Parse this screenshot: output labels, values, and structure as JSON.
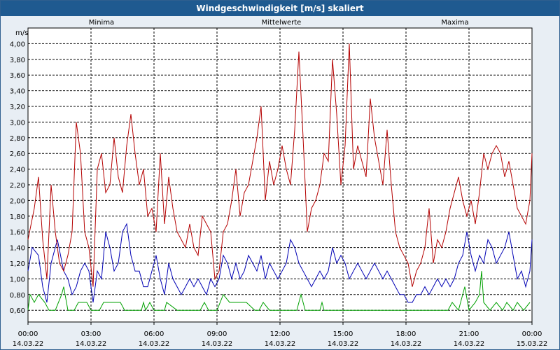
{
  "window": {
    "title": "Windgeschwindigkeit [m/s] skaliert"
  },
  "chart_data": {
    "type": "line",
    "title": "Windgeschwindigkeit [m/s] skaliert",
    "ylabel": "m/s",
    "ylim": [
      0.45,
      4.2
    ],
    "xlim": [
      "00:00",
      "24:00"
    ],
    "y_ticks": [
      "0,60",
      "0,80",
      "1,00",
      "1,20",
      "1,40",
      "1,60",
      "1,80",
      "2,00",
      "2,20",
      "2,40",
      "2,60",
      "2,80",
      "3,00",
      "3,20",
      "3,40",
      "3,60",
      "3,80",
      "4,00"
    ],
    "x_ticks": [
      {
        "time": "00:00",
        "date": "14.03.22"
      },
      {
        "time": "03:00",
        "date": "14.03.22"
      },
      {
        "time": "06:00",
        "date": "14.03.22"
      },
      {
        "time": "09:00",
        "date": "14.03.22"
      },
      {
        "time": "12:00",
        "date": "14.03.22"
      },
      {
        "time": "15:00",
        "date": "14.03.22"
      },
      {
        "time": "18:00",
        "date": "14.03.22"
      },
      {
        "time": "21:00",
        "date": "14.03.22"
      },
      {
        "time": "00:00",
        "date": "15.03.22"
      }
    ],
    "grid": true,
    "legend_position": "top",
    "series": [
      {
        "name": "Minima",
        "color": "#00a000",
        "points": [
          [
            0,
            0.6
          ],
          [
            0.1,
            0.8
          ],
          [
            0.3,
            0.7
          ],
          [
            0.5,
            0.8
          ],
          [
            0.8,
            0.7
          ],
          [
            1.0,
            0.6
          ],
          [
            1.3,
            0.6
          ],
          [
            1.6,
            0.8
          ],
          [
            1.7,
            0.9
          ],
          [
            1.9,
            0.6
          ],
          [
            2.2,
            0.6
          ],
          [
            2.4,
            0.7
          ],
          [
            2.8,
            0.7
          ],
          [
            3.0,
            0.6
          ],
          [
            3.4,
            0.6
          ],
          [
            3.6,
            0.7
          ],
          [
            4.4,
            0.7
          ],
          [
            4.6,
            0.6
          ],
          [
            5.4,
            0.6
          ],
          [
            5.5,
            0.7
          ],
          [
            5.6,
            0.6
          ],
          [
            5.8,
            0.7
          ],
          [
            6.0,
            0.6
          ],
          [
            6.5,
            0.6
          ],
          [
            6.6,
            0.7
          ],
          [
            7.1,
            0.6
          ],
          [
            8.2,
            0.6
          ],
          [
            8.4,
            0.7
          ],
          [
            8.6,
            0.6
          ],
          [
            9.0,
            0.6
          ],
          [
            9.3,
            0.8
          ],
          [
            9.6,
            0.7
          ],
          [
            10.4,
            0.7
          ],
          [
            10.8,
            0.6
          ],
          [
            11.0,
            0.6
          ],
          [
            11.2,
            0.7
          ],
          [
            11.5,
            0.6
          ],
          [
            12.8,
            0.6
          ],
          [
            13.0,
            0.8
          ],
          [
            13.2,
            0.6
          ],
          [
            13.9,
            0.6
          ],
          [
            14.0,
            0.7
          ],
          [
            14.1,
            0.6
          ],
          [
            20.0,
            0.6
          ],
          [
            20.2,
            0.7
          ],
          [
            20.5,
            0.6
          ],
          [
            20.8,
            0.9
          ],
          [
            21.0,
            0.6
          ],
          [
            21.3,
            0.7
          ],
          [
            21.5,
            0.8
          ],
          [
            21.6,
            1.1
          ],
          [
            21.7,
            0.7
          ],
          [
            22.0,
            0.6
          ],
          [
            22.3,
            0.7
          ],
          [
            22.6,
            0.6
          ],
          [
            22.8,
            0.7
          ],
          [
            23.1,
            0.6
          ],
          [
            23.3,
            0.7
          ],
          [
            23.6,
            0.6
          ],
          [
            23.9,
            0.7
          ]
        ]
      },
      {
        "name": "Mittelwerte",
        "color": "#0000b4",
        "points": [
          [
            0,
            1.1
          ],
          [
            0.2,
            1.4
          ],
          [
            0.5,
            1.3
          ],
          [
            0.7,
            0.9
          ],
          [
            0.9,
            0.7
          ],
          [
            1.1,
            1.2
          ],
          [
            1.4,
            1.5
          ],
          [
            1.7,
            1.1
          ],
          [
            1.9,
            1.0
          ],
          [
            2.1,
            0.8
          ],
          [
            2.3,
            0.9
          ],
          [
            2.5,
            1.1
          ],
          [
            2.7,
            1.2
          ],
          [
            2.9,
            1.1
          ],
          [
            3.1,
            0.7
          ],
          [
            3.3,
            1.1
          ],
          [
            3.5,
            1.0
          ],
          [
            3.7,
            1.6
          ],
          [
            3.9,
            1.4
          ],
          [
            4.1,
            1.1
          ],
          [
            4.3,
            1.2
          ],
          [
            4.5,
            1.6
          ],
          [
            4.7,
            1.7
          ],
          [
            4.9,
            1.3
          ],
          [
            5.1,
            1.1
          ],
          [
            5.3,
            1.1
          ],
          [
            5.5,
            0.9
          ],
          [
            5.7,
            0.9
          ],
          [
            5.9,
            1.1
          ],
          [
            6.1,
            1.3
          ],
          [
            6.3,
            1.0
          ],
          [
            6.5,
            0.8
          ],
          [
            6.7,
            1.2
          ],
          [
            6.9,
            1.0
          ],
          [
            7.1,
            0.9
          ],
          [
            7.3,
            0.8
          ],
          [
            7.5,
            0.9
          ],
          [
            7.7,
            1.0
          ],
          [
            7.9,
            0.9
          ],
          [
            8.1,
            1.0
          ],
          [
            8.3,
            0.9
          ],
          [
            8.5,
            0.8
          ],
          [
            8.7,
            1.0
          ],
          [
            8.9,
            0.9
          ],
          [
            9.1,
            1.0
          ],
          [
            9.3,
            1.3
          ],
          [
            9.5,
            1.2
          ],
          [
            9.7,
            1.0
          ],
          [
            9.9,
            1.2
          ],
          [
            10.1,
            1.0
          ],
          [
            10.3,
            1.1
          ],
          [
            10.5,
            1.3
          ],
          [
            10.7,
            1.2
          ],
          [
            10.9,
            1.1
          ],
          [
            11.1,
            1.3
          ],
          [
            11.3,
            1.0
          ],
          [
            11.5,
            1.2
          ],
          [
            11.7,
            1.1
          ],
          [
            11.9,
            1.0
          ],
          [
            12.1,
            1.1
          ],
          [
            12.3,
            1.2
          ],
          [
            12.5,
            1.5
          ],
          [
            12.7,
            1.4
          ],
          [
            12.9,
            1.2
          ],
          [
            13.1,
            1.1
          ],
          [
            13.3,
            1.0
          ],
          [
            13.5,
            0.9
          ],
          [
            13.7,
            1.0
          ],
          [
            13.9,
            1.1
          ],
          [
            14.1,
            1.0
          ],
          [
            14.3,
            1.1
          ],
          [
            14.5,
            1.4
          ],
          [
            14.7,
            1.2
          ],
          [
            14.9,
            1.3
          ],
          [
            15.1,
            1.2
          ],
          [
            15.3,
            1.0
          ],
          [
            15.5,
            1.1
          ],
          [
            15.7,
            1.2
          ],
          [
            15.9,
            1.1
          ],
          [
            16.1,
            1.0
          ],
          [
            16.3,
            1.1
          ],
          [
            16.5,
            1.2
          ],
          [
            16.7,
            1.1
          ],
          [
            16.9,
            1.0
          ],
          [
            17.1,
            1.1
          ],
          [
            17.3,
            1.0
          ],
          [
            17.5,
            0.9
          ],
          [
            17.7,
            0.8
          ],
          [
            17.9,
            0.8
          ],
          [
            18.1,
            0.7
          ],
          [
            18.3,
            0.7
          ],
          [
            18.5,
            0.8
          ],
          [
            18.7,
            0.8
          ],
          [
            18.9,
            0.9
          ],
          [
            19.1,
            0.8
          ],
          [
            19.3,
            0.9
          ],
          [
            19.5,
            1.0
          ],
          [
            19.7,
            0.9
          ],
          [
            19.9,
            1.0
          ],
          [
            20.1,
            0.9
          ],
          [
            20.3,
            1.0
          ],
          [
            20.5,
            1.2
          ],
          [
            20.7,
            1.3
          ],
          [
            20.9,
            1.6
          ],
          [
            21.1,
            1.3
          ],
          [
            21.3,
            1.1
          ],
          [
            21.5,
            1.3
          ],
          [
            21.7,
            1.2
          ],
          [
            21.9,
            1.5
          ],
          [
            22.1,
            1.4
          ],
          [
            22.3,
            1.2
          ],
          [
            22.5,
            1.3
          ],
          [
            22.7,
            1.4
          ],
          [
            22.9,
            1.6
          ],
          [
            23.1,
            1.3
          ],
          [
            23.3,
            1.0
          ],
          [
            23.5,
            1.1
          ],
          [
            23.7,
            0.9
          ],
          [
            23.9,
            1.1
          ],
          [
            24,
            1.5
          ]
        ]
      },
      {
        "name": "Maxima",
        "color": "#b40000",
        "points": [
          [
            0,
            1.5
          ],
          [
            0.3,
            1.9
          ],
          [
            0.5,
            2.3
          ],
          [
            0.7,
            1.5
          ],
          [
            0.9,
            1.0
          ],
          [
            1.1,
            2.2
          ],
          [
            1.3,
            1.6
          ],
          [
            1.5,
            1.2
          ],
          [
            1.7,
            1.1
          ],
          [
            1.9,
            1.3
          ],
          [
            2.1,
            1.6
          ],
          [
            2.3,
            3.0
          ],
          [
            2.5,
            2.6
          ],
          [
            2.7,
            1.6
          ],
          [
            2.9,
            1.4
          ],
          [
            3.1,
            0.9
          ],
          [
            3.3,
            2.4
          ],
          [
            3.5,
            2.6
          ],
          [
            3.7,
            2.1
          ],
          [
            3.9,
            2.2
          ],
          [
            4.1,
            2.8
          ],
          [
            4.3,
            2.3
          ],
          [
            4.5,
            2.1
          ],
          [
            4.7,
            2.7
          ],
          [
            4.9,
            3.1
          ],
          [
            5.1,
            2.6
          ],
          [
            5.3,
            2.2
          ],
          [
            5.5,
            2.4
          ],
          [
            5.7,
            1.8
          ],
          [
            5.9,
            1.9
          ],
          [
            6.1,
            1.6
          ],
          [
            6.3,
            2.6
          ],
          [
            6.5,
            1.7
          ],
          [
            6.7,
            2.3
          ],
          [
            6.9,
            1.9
          ],
          [
            7.1,
            1.6
          ],
          [
            7.3,
            1.5
          ],
          [
            7.5,
            1.4
          ],
          [
            7.7,
            1.7
          ],
          [
            7.9,
            1.4
          ],
          [
            8.1,
            1.3
          ],
          [
            8.3,
            1.8
          ],
          [
            8.5,
            1.7
          ],
          [
            8.7,
            1.6
          ],
          [
            8.9,
            1.0
          ],
          [
            9.1,
            1.1
          ],
          [
            9.3,
            1.6
          ],
          [
            9.5,
            1.7
          ],
          [
            9.7,
            2.0
          ],
          [
            9.9,
            2.4
          ],
          [
            10.1,
            1.8
          ],
          [
            10.3,
            2.1
          ],
          [
            10.5,
            2.2
          ],
          [
            10.7,
            2.5
          ],
          [
            10.9,
            2.8
          ],
          [
            11.1,
            3.2
          ],
          [
            11.3,
            2.0
          ],
          [
            11.5,
            2.5
          ],
          [
            11.7,
            2.2
          ],
          [
            11.9,
            2.4
          ],
          [
            12.1,
            2.7
          ],
          [
            12.3,
            2.4
          ],
          [
            12.5,
            2.2
          ],
          [
            12.7,
            2.9
          ],
          [
            12.9,
            3.9
          ],
          [
            13.1,
            2.8
          ],
          [
            13.3,
            1.6
          ],
          [
            13.5,
            1.9
          ],
          [
            13.7,
            2.0
          ],
          [
            13.9,
            2.2
          ],
          [
            14.1,
            2.6
          ],
          [
            14.3,
            2.5
          ],
          [
            14.5,
            3.8
          ],
          [
            14.7,
            3.1
          ],
          [
            14.9,
            2.2
          ],
          [
            15.1,
            2.7
          ],
          [
            15.3,
            4.0
          ],
          [
            15.5,
            2.4
          ],
          [
            15.7,
            2.7
          ],
          [
            15.9,
            2.5
          ],
          [
            16.1,
            2.3
          ],
          [
            16.3,
            3.3
          ],
          [
            16.5,
            2.8
          ],
          [
            16.7,
            2.5
          ],
          [
            16.9,
            2.2
          ],
          [
            17.1,
            2.9
          ],
          [
            17.3,
            2.2
          ],
          [
            17.5,
            1.6
          ],
          [
            17.7,
            1.4
          ],
          [
            17.9,
            1.3
          ],
          [
            18.1,
            1.2
          ],
          [
            18.3,
            0.9
          ],
          [
            18.5,
            1.1
          ],
          [
            18.7,
            1.2
          ],
          [
            18.9,
            1.4
          ],
          [
            19.1,
            1.9
          ],
          [
            19.3,
            1.2
          ],
          [
            19.5,
            1.5
          ],
          [
            19.7,
            1.4
          ],
          [
            19.9,
            1.6
          ],
          [
            20.1,
            1.9
          ],
          [
            20.3,
            2.1
          ],
          [
            20.5,
            2.3
          ],
          [
            20.7,
            2.0
          ],
          [
            20.9,
            1.8
          ],
          [
            21.1,
            2.0
          ],
          [
            21.3,
            1.7
          ],
          [
            21.5,
            2.1
          ],
          [
            21.7,
            2.6
          ],
          [
            21.9,
            2.4
          ],
          [
            22.1,
            2.6
          ],
          [
            22.3,
            2.7
          ],
          [
            22.5,
            2.6
          ],
          [
            22.7,
            2.3
          ],
          [
            22.9,
            2.5
          ],
          [
            23.1,
            2.2
          ],
          [
            23.3,
            1.9
          ],
          [
            23.5,
            1.8
          ],
          [
            23.7,
            1.7
          ],
          [
            23.9,
            2.0
          ],
          [
            24,
            2.6
          ]
        ]
      }
    ]
  }
}
